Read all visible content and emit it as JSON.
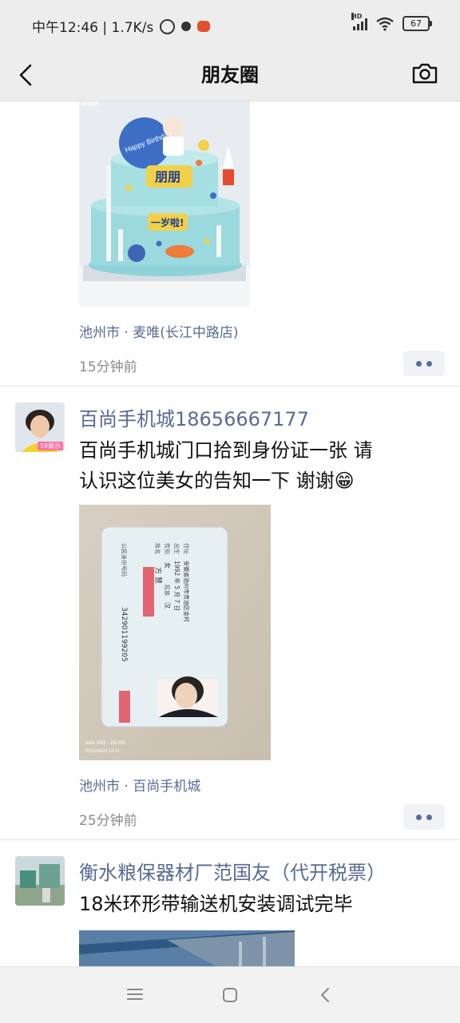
{
  "status_bar": {
    "time": "中午12:46 | 1.7K/s",
    "hd_label": "HD",
    "battery": "67"
  },
  "nav": {
    "title": "朋友圈"
  },
  "posts": [
    {
      "photo_text_top": "tion",
      "cake_badge": "Happy Birthday",
      "cake_name": "朋朋",
      "cake_label": "一岁啦!",
      "location": "池州市 · 麦唯(长江中路店)",
      "time": "15分钟前"
    },
    {
      "author": "百尚手机城18656667177",
      "avatar_badge": "59展示",
      "text_line1": "百尚手机城门口拾到身份证一张 请",
      "text_line2": "认识这位美女的告知一下  谢谢😁",
      "id_card": {
        "name_label": "姓名",
        "name_value": "方 慧",
        "sex_label": "性别",
        "sex_value": "女",
        "ethnic_label": "民族",
        "ethnic_value": "汉",
        "birth_label": "出生",
        "birth_value": "1992 年 5 月 7 日",
        "addr_label": "住址",
        "addr_value": "安徽省池州市贵池区金村",
        "id_label": "公民身份号码",
        "id_value": "342901199205"
      },
      "watermark": "vivo X60 · ZEISS",
      "watermark_date": "2021/04/22 12:17",
      "location": "池州市 · 百尚手机城",
      "time": "25分钟前"
    },
    {
      "author": "衡水粮保器材厂范国友（代开税票）",
      "text_line1": "18米环形带输送机安装调试完毕"
    }
  ]
}
